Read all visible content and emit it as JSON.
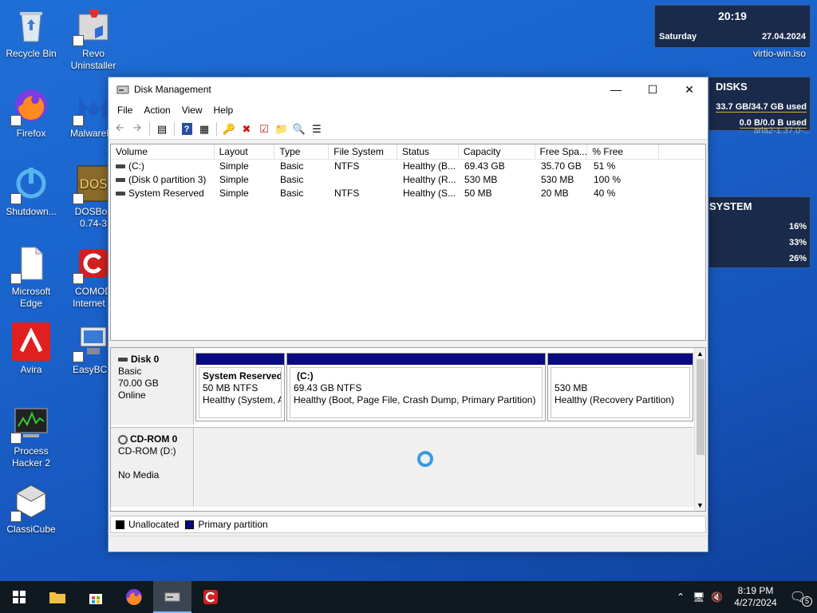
{
  "desktop": {
    "icons": [
      {
        "label": "Recycle Bin"
      },
      {
        "label": "Revo Uninstaller"
      },
      {
        "label": "Firefox"
      },
      {
        "label": "Malwareby"
      },
      {
        "label": "Shutdown..."
      },
      {
        "label": "DOSBox 0.74-3"
      },
      {
        "label": "Microsoft Edge"
      },
      {
        "label": "COMOD Internet S"
      },
      {
        "label": "Avira"
      },
      {
        "label": "EasyBCD"
      },
      {
        "label": "Process Hacker 2"
      },
      {
        "label": "ClassiCube"
      }
    ]
  },
  "gadgets": {
    "clock": {
      "time": "20:19",
      "day": "Saturday",
      "date": "27.04.2024",
      "file": "virtio-win.iso"
    },
    "disks": {
      "title": "DISKS",
      "line1": "33.7 GB/34.7 GB used",
      "line2": "0.0 B/0.0 B used",
      "file": "aria2-1.37.0-..."
    },
    "system": {
      "title": "SYSTEM",
      "v1": "16%",
      "v2": "33%",
      "v3": "26%"
    }
  },
  "window": {
    "title": "Disk Management",
    "menu": [
      "File",
      "Action",
      "View",
      "Help"
    ],
    "columns": [
      "Volume",
      "Layout",
      "Type",
      "File System",
      "Status",
      "Capacity",
      "Free Spa...",
      "% Free"
    ],
    "rows": [
      {
        "volume": "(C:)",
        "layout": "Simple",
        "type": "Basic",
        "fs": "NTFS",
        "status": "Healthy (B...",
        "capacity": "69.43 GB",
        "free": "35.70 GB",
        "pct": "51 %"
      },
      {
        "volume": "(Disk 0 partition 3)",
        "layout": "Simple",
        "type": "Basic",
        "fs": "",
        "status": "Healthy (R...",
        "capacity": "530 MB",
        "free": "530 MB",
        "pct": "100 %"
      },
      {
        "volume": "System Reserved",
        "layout": "Simple",
        "type": "Basic",
        "fs": "NTFS",
        "status": "Healthy (S...",
        "capacity": "50 MB",
        "free": "20 MB",
        "pct": "40 %"
      }
    ],
    "disk0": {
      "name": "Disk 0",
      "type": "Basic",
      "size": "70.00 GB",
      "state": "Online",
      "partitions": [
        {
          "name": "System Reserved",
          "detail": "50 MB NTFS",
          "status": "Healthy (System, A"
        },
        {
          "name": "(C:)",
          "detail": "69.43 GB NTFS",
          "status": "Healthy (Boot, Page File, Crash Dump, Primary Partition)"
        },
        {
          "name": "",
          "detail": "530 MB",
          "status": "Healthy (Recovery Partition)"
        }
      ]
    },
    "cdrom0": {
      "name": "CD-ROM 0",
      "type": "CD-ROM (D:)",
      "media": "No Media"
    },
    "legend": {
      "unallocated": "Unallocated",
      "primary": "Primary partition",
      "unallocated_color": "#000000",
      "primary_color": "#0a0a82"
    }
  },
  "taskbar": {
    "time": "8:19 PM",
    "date": "4/27/2024",
    "notifications": "5"
  }
}
